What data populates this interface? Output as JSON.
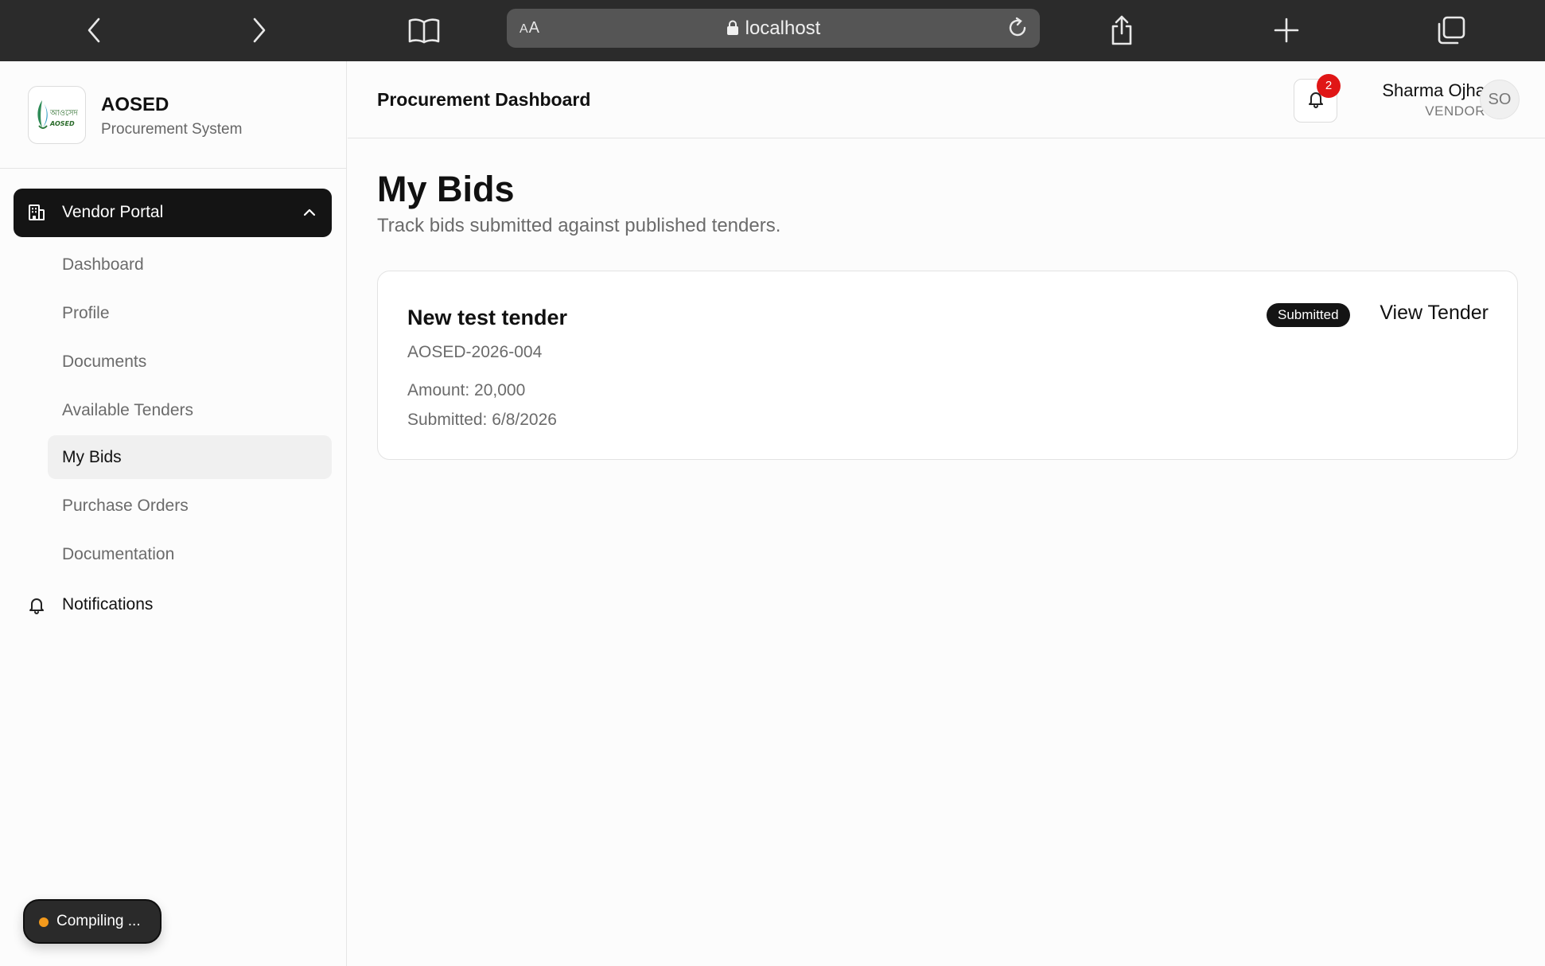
{
  "browser": {
    "url_size_label_big": "A",
    "url_size_label_small": "A",
    "url": "localhost"
  },
  "brand": {
    "logo_text": "আওসেদ",
    "logo_sub": "AOSED",
    "name": "AOSED",
    "subtitle": "Procurement System"
  },
  "sidebar": {
    "parent_label": "Vendor Portal",
    "items": [
      {
        "label": "Dashboard",
        "active": false
      },
      {
        "label": "Profile",
        "active": false
      },
      {
        "label": "Documents",
        "active": false
      },
      {
        "label": "Available Tenders",
        "active": false
      },
      {
        "label": "My Bids",
        "active": true
      },
      {
        "label": "Purchase Orders",
        "active": false
      },
      {
        "label": "Documentation",
        "active": false
      }
    ],
    "notifications_label": "Notifications"
  },
  "compiling": {
    "label": "Compiling ..."
  },
  "header": {
    "title": "Procurement Dashboard",
    "notification_count": "2",
    "user_name": "Sharma Ojha",
    "user_role": "VENDOR",
    "avatar_initials": "SO"
  },
  "main": {
    "title": "My Bids",
    "subtitle": "Track bids submitted against published tenders.",
    "bids": [
      {
        "title": "New test tender",
        "reference": "AOSED-2026-004",
        "amount": "Amount: 20,000",
        "submitted": "Submitted: 6/8/2026",
        "status": "Submitted",
        "action": "View Tender"
      }
    ]
  },
  "colors": {
    "accent": "#141414",
    "badge_red": "#e01616",
    "compiling_dot": "#f39a1c"
  }
}
